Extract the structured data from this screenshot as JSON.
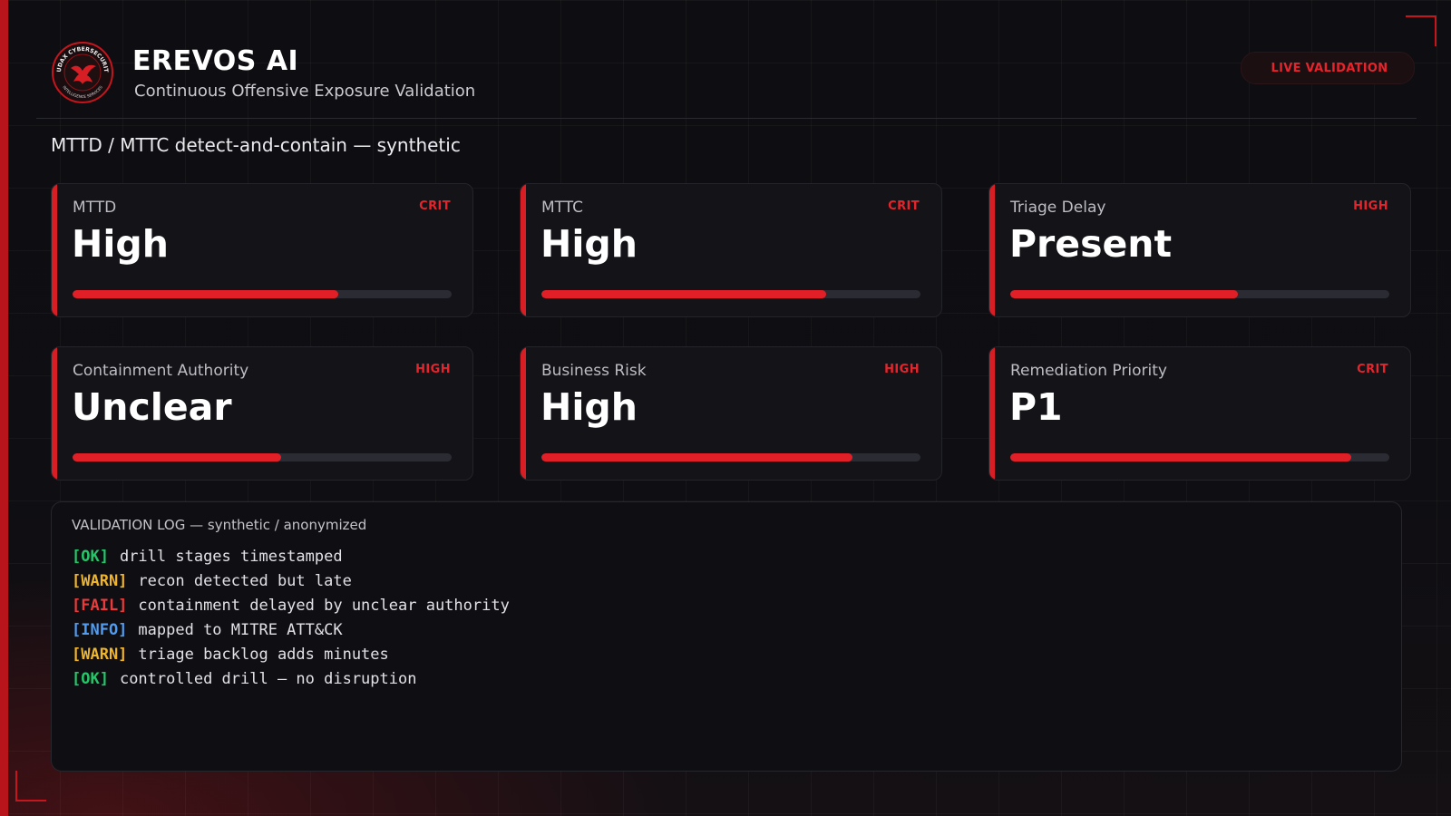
{
  "colors": {
    "accent": "#d81e25",
    "ok": "#25c66a",
    "warn": "#f0b429",
    "fail": "#ea3a3a",
    "info": "#4f9cf2"
  },
  "header": {
    "logo_ring_text_top": "AUDAX CYBERSECURITY",
    "logo_ring_text_bottom": "INTELLIGENCE SERVICES",
    "title": "EREVOS AI",
    "subtitle": "Continuous Offensive Exposure Validation",
    "live_badge_icon": "",
    "live_badge_label": "LIVE VALIDATION"
  },
  "section_title": "MTTD / MTTC detect-and-contain — synthetic",
  "metrics": [
    {
      "label": "MTTD",
      "severity": "CRIT",
      "value": "High",
      "level": 0.7
    },
    {
      "label": "MTTC",
      "severity": "CRIT",
      "value": "High",
      "level": 0.75
    },
    {
      "label": "Triage Delay",
      "severity": "HIGH",
      "value": "Present",
      "level": 0.6
    },
    {
      "label": "Containment Authority",
      "severity": "HIGH",
      "value": "Unclear",
      "level": 0.55
    },
    {
      "label": "Business Risk",
      "severity": "HIGH",
      "value": "High",
      "level": 0.82
    },
    {
      "label": "Remediation Priority",
      "severity": "CRIT",
      "value": "P1",
      "level": 0.9
    }
  ],
  "log": {
    "title": "VALIDATION LOG — synthetic / anonymized",
    "entries": [
      {
        "tag": "[OK]",
        "type": "ok",
        "text": "drill stages timestamped"
      },
      {
        "tag": "[WARN]",
        "type": "warn",
        "text": "recon detected but late"
      },
      {
        "tag": "[FAIL]",
        "type": "fail",
        "text": "containment delayed by unclear authority"
      },
      {
        "tag": "[INFO]",
        "type": "info",
        "text": "mapped to MITRE ATT&CK"
      },
      {
        "tag": "[WARN]",
        "type": "warn",
        "text": "triage backlog adds minutes"
      },
      {
        "tag": "[OK]",
        "type": "ok",
        "text": "controlled drill — no disruption"
      }
    ]
  }
}
